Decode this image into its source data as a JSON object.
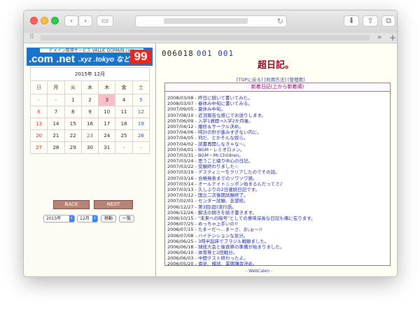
{
  "browser": {
    "back_label": "‹",
    "forward_label": "›",
    "sidebar_label": "▭",
    "reload_label": "↻",
    "download_label": "⬇",
    "share_label": "⇪",
    "newtab_label": "⧉",
    "grid_label": "⠿",
    "more_label": "»",
    "plus_label": "+"
  },
  "banner": {
    "top_text": "ドメイン取得サービス VALUE DOMAIN.com",
    "tld_text": ".com .net",
    "tld_text2": ".xyz .tokyo など",
    "price": "99"
  },
  "calendar": {
    "title": "2015年 12月",
    "weekdays": [
      "日",
      "月",
      "火",
      "水",
      "木",
      "金",
      "土"
    ],
    "weeks": [
      [
        "-",
        "-",
        "1",
        "2",
        "3",
        "4",
        "5"
      ],
      [
        "6",
        "7",
        "8",
        "9",
        "10",
        "11",
        "12"
      ],
      [
        "13",
        "14",
        "15",
        "16",
        "17",
        "18",
        "19"
      ],
      [
        "20",
        "21",
        "22",
        "23",
        "24",
        "25",
        "26"
      ],
      [
        "27",
        "28",
        "29",
        "30",
        "31",
        "-",
        "-"
      ]
    ],
    "back_label": "BACK",
    "next_label": "NEXT",
    "year_value": "2015年",
    "month_value": "12月",
    "move_label": "移動",
    "list_label": "一覧"
  },
  "counter": {
    "main": "006018",
    "sub": "001 001"
  },
  "site_title": "超日記。",
  "links": [
    "[TOPに戻る]",
    "[利用方法]",
    "[管理用]"
  ],
  "diary": {
    "heading": "新着日記(上から新着順)",
    "entries": [
      {
        "date": "2008/03/08",
        "title": "昨日に続いて書いてみた。"
      },
      {
        "date": "2008/03/07",
        "title": "春休み中旬に書いてみる。"
      },
      {
        "date": "2007/09/05",
        "title": "夏休み中旬。"
      },
      {
        "date": "2007/08/10",
        "title": "近況報告な感じでお送りします。"
      },
      {
        "date": "2007/06/09",
        "title": "入学1週間→入学2か月後。"
      },
      {
        "date": "2007/04/12",
        "title": "履修＆サークル決め。"
      },
      {
        "date": "2007/04/06",
        "title": "時計の針が進みすぎない内に。"
      },
      {
        "date": "2007/04/05",
        "title": "何だ、とかそんな奴ら。"
      },
      {
        "date": "2007/04/02",
        "title": "読書再開しなきゃな〜。"
      },
      {
        "date": "2007/04/01",
        "title": "BGM・レミオロメン。"
      },
      {
        "date": "2007/03/31",
        "title": "BGM・Mr.Children。"
      },
      {
        "date": "2007/03/24",
        "title": "思うこと綴り中心の日記。"
      },
      {
        "date": "2007/03/22",
        "title": "受験終わりました☆"
      },
      {
        "date": "2007/03/19",
        "title": "デスティニーをクリアしたのでその話。"
      },
      {
        "date": "2007/03/16",
        "title": "合格発表までのソワソワ感。"
      },
      {
        "date": "2007/03/14",
        "title": "オールナイトニッポン始まるんだってさ♪"
      },
      {
        "date": "2007/03/13",
        "title": "久しぶりの2日連続日記です。"
      },
      {
        "date": "2007/03/12",
        "title": "国立二次後期試験終了。"
      },
      {
        "date": "2007/02/01",
        "title": "センター試験、志望校。"
      },
      {
        "date": "2006/12/27",
        "title": "第3回(超)流行語。"
      },
      {
        "date": "2006/12/26",
        "title": "解法の問きを続き書きます。"
      },
      {
        "date": "2006/10/15",
        "title": "\"未来への暗号\"としての意味深長な日記も偶に在ります。"
      },
      {
        "date": "2006/07/25",
        "title": "めっちゃ上手いの!!"
      },
      {
        "date": "2006/07/15",
        "title": "たまーだ〜…まーさ、お¡ぉ〜!!"
      },
      {
        "date": "2006/07/08",
        "title": "ハイテンションな気分。"
      },
      {
        "date": "2006/06/25",
        "title": "3時半起床でブラジル戦観ました。"
      },
      {
        "date": "2006/06/18",
        "title": "球技大会と後夜祭の準備が始まりました。"
      },
      {
        "date": "2006/06/10",
        "title": "体育祭と2回戦分。"
      },
      {
        "date": "2006/06/03",
        "title": "中間テスト終わったよ。"
      },
      {
        "date": "2006/05/20",
        "title": "遠足、模試、業期講習決め。"
      }
    ]
  },
  "footer": "- WebCalen -"
}
